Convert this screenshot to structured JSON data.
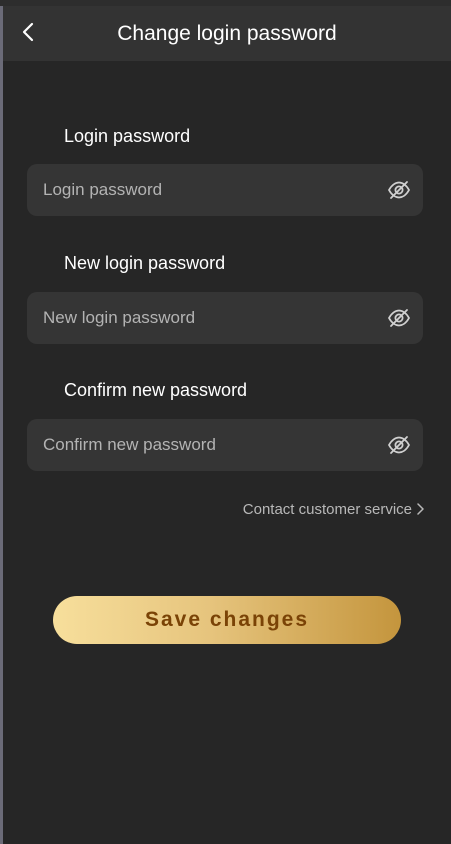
{
  "header": {
    "title": "Change login password",
    "back_icon": "chevron-left-icon"
  },
  "fields": [
    {
      "label": "Login password",
      "placeholder": "Login password",
      "value": "",
      "icon": "eye-off-icon"
    },
    {
      "label": "New login password",
      "placeholder": "New login password",
      "value": "",
      "icon": "eye-off-icon"
    },
    {
      "label": "Confirm new password",
      "placeholder": "Confirm new password",
      "value": "",
      "icon": "eye-off-icon"
    }
  ],
  "contact": {
    "label": "Contact customer service",
    "icon": "chevron-right-icon"
  },
  "save_button": {
    "label": "Save changes"
  },
  "colors": {
    "background": "#262626",
    "header": "#333333",
    "field": "#353535",
    "button_gradient_start": "#f7df9c",
    "button_gradient_end": "#c4953d",
    "button_text": "#7a4306"
  }
}
